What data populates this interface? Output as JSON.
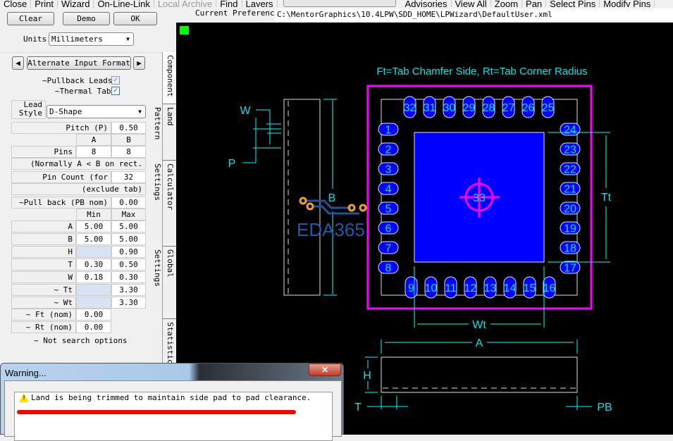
{
  "menu": [
    "Close",
    "Print",
    "Wizard",
    "On-Line-Link",
    "Local Archive",
    "Find",
    "Layers",
    "Advisories",
    "View All",
    "Zoom",
    "Pan",
    "Select Pins",
    "Modify Pins"
  ],
  "buttons": {
    "clear": "Clear",
    "demo": "Demo",
    "ok": "OK"
  },
  "units": {
    "label": "Units",
    "value": "Millimeters"
  },
  "alt_input": "Alternate Input Format",
  "checks": {
    "pullback": "~Pullback Leads",
    "thermal": "~Thermal Tab"
  },
  "lead_style": {
    "label1": "Lead",
    "label2": "Style",
    "value": "D-Shape"
  },
  "pitch": {
    "label": "Pitch (P)",
    "value": "0.50"
  },
  "cols": {
    "a": "A",
    "b": "B",
    "min": "Min",
    "max": "Max"
  },
  "pins": {
    "label": "Pins",
    "a": "8",
    "b": "8",
    "note": "(Normally A < B on rect."
  },
  "pin_count": {
    "label": "Pin Count (for search)",
    "value": "32",
    "note": "(exclude tab)"
  },
  "pull_back": {
    "label": "~Pull back (PB nom)",
    "value": "0.00"
  },
  "dims": [
    {
      "label": "A",
      "min": "5.00",
      "max": "5.00"
    },
    {
      "label": "B",
      "min": "5.00",
      "max": "5.00"
    },
    {
      "label": "H",
      "min": "",
      "max": "0.90"
    },
    {
      "label": "T",
      "min": "0.30",
      "max": "0.50"
    },
    {
      "label": "W",
      "min": "0.18",
      "max": "0.30"
    },
    {
      "label": "~ Tt",
      "min": "",
      "max": "3.30"
    },
    {
      "label": "~ Wt",
      "min": "",
      "max": "3.30"
    }
  ],
  "noms": [
    {
      "label": "~ Ft (nom)",
      "value": "0.00"
    },
    {
      "label": "~ Rt (nom)",
      "value": "0.00"
    }
  ],
  "footnote": "~ Not search options",
  "tabs": [
    "Component",
    "Land Pattern",
    "Calculator Settings",
    "Global Settings",
    "Statistics"
  ],
  "preference": {
    "label": "Current Preference",
    "path": "C:\\MentorGraphics\\10.4LPW\\SDD_HOME\\LPWizard\\DefaultUser.xml"
  },
  "drawing": {
    "title": "Ft=Tab Chamfer Side, Rt=Tab Corner Radius",
    "left_pins": [
      "1",
      "2",
      "3",
      "4",
      "5",
      "6",
      "7",
      "8"
    ],
    "bottom_pins": [
      "9",
      "10",
      "11",
      "12",
      "13",
      "14",
      "15",
      "16"
    ],
    "right_pins": [
      "17",
      "18",
      "19",
      "20",
      "21",
      "22",
      "23",
      "24"
    ],
    "top_pins": [
      "25",
      "26",
      "27",
      "28",
      "29",
      "30",
      "31",
      "32"
    ],
    "tab_pin": "33",
    "labels": {
      "w": "W",
      "p": "P",
      "b": "B",
      "tt": "Tt",
      "wt": "Wt",
      "a": "A",
      "h": "H",
      "t": "T",
      "pb": "PB"
    },
    "watermark": "EDA365",
    "colors": {
      "pad": "#0000ff",
      "courtyard": "#ff00ff",
      "dim": "#00ffff",
      "outline": "#e0e0e0"
    }
  },
  "dialog": {
    "title": "Warning...",
    "close": "✕",
    "message": "Land is being trimmed to maintain side pad to pad clearance."
  }
}
